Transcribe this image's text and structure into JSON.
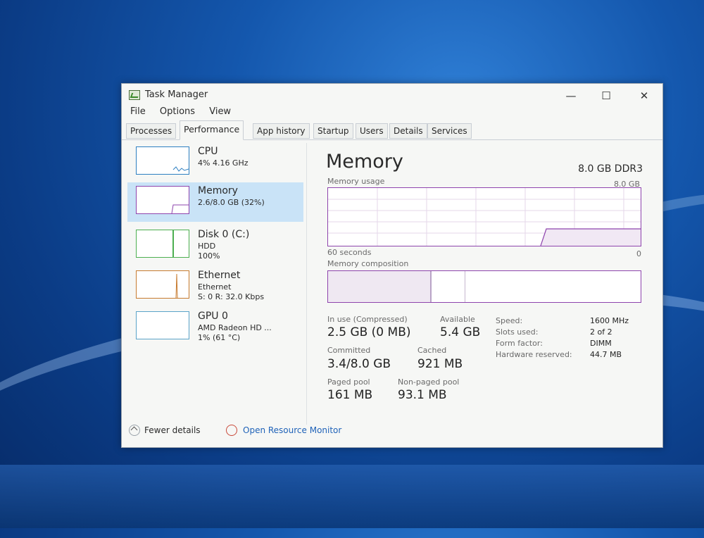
{
  "window": {
    "title": "Task Manager"
  },
  "menu": [
    "File",
    "Options",
    "View"
  ],
  "tabs": [
    "Processes",
    "Performance",
    "App history",
    "Startup",
    "Users",
    "Details",
    "Services"
  ],
  "sidebar": {
    "items": [
      {
        "name": "CPU",
        "line1": "4% 4.16 GHz",
        "line2": ""
      },
      {
        "name": "Memory",
        "line1": "2.6/8.0 GB (32%)",
        "line2": ""
      },
      {
        "name": "Disk 0 (C:)",
        "line1": "HDD",
        "line2": "100%"
      },
      {
        "name": "Ethernet",
        "line1": "Ethernet",
        "line2": "S: 0 R: 32.0 Kbps"
      },
      {
        "name": "GPU 0",
        "line1": "AMD Radeon HD ...",
        "line2": "1% (61 °C)"
      }
    ]
  },
  "main": {
    "title": "Memory",
    "type": "8.0 GB DDR3",
    "usage_label": "Memory usage",
    "usage_max": "8.0 GB",
    "time_label": "60 seconds",
    "zero_label": "0",
    "composition_label": "Memory composition",
    "stats": {
      "in_use_label": "In use (Compressed)",
      "in_use": "2.5 GB (0 MB)",
      "available_label": "Available",
      "available": "5.4 GB",
      "committed_label": "Committed",
      "committed": "3.4/8.0 GB",
      "cached_label": "Cached",
      "cached": "921 MB",
      "paged_label": "Paged pool",
      "paged": "161 MB",
      "nonpaged_label": "Non-paged pool",
      "nonpaged": "93.1 MB"
    },
    "specs": [
      {
        "key": "Speed:",
        "value": "1600 MHz"
      },
      {
        "key": "Slots used:",
        "value": "2 of 2"
      },
      {
        "key": "Form factor:",
        "value": "DIMM"
      },
      {
        "key": "Hardware reserved:",
        "value": "44.7 MB"
      }
    ]
  },
  "footer": {
    "fewer": "Fewer details",
    "monitor": "Open Resource Monitor"
  },
  "colors": {
    "memory": "#8e44ad",
    "cpu": "#2d7fc1",
    "disk": "#4caf50",
    "ethernet": "#c77b2f",
    "selection": "#c9e3f7"
  },
  "icons": [
    "task-manager-icon",
    "minimize-icon",
    "maximize-icon",
    "close-icon",
    "chevron-up-icon",
    "resource-monitor-icon"
  ]
}
